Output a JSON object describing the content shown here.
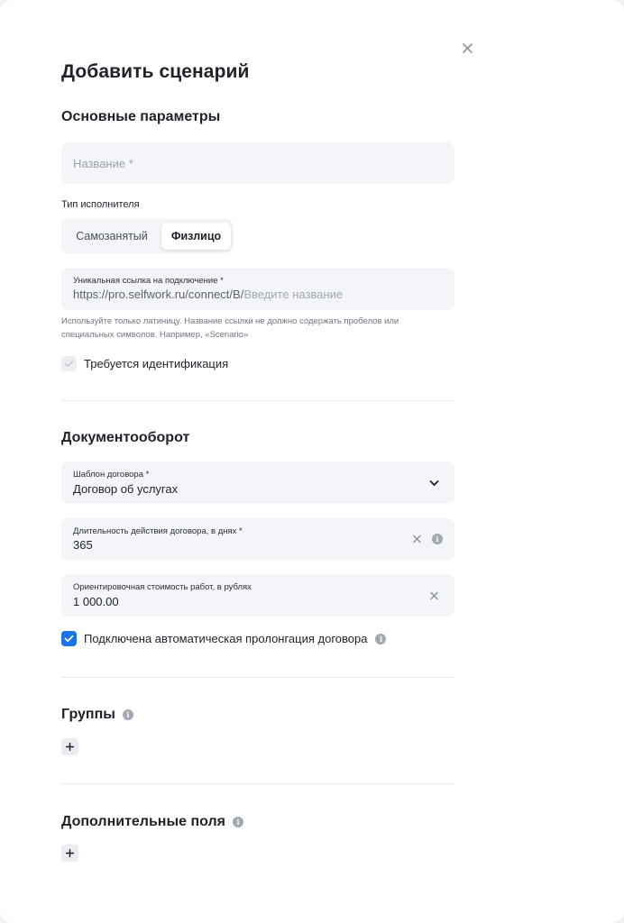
{
  "modal": {
    "title": "Добавить сценарий",
    "close_icon": "close-icon"
  },
  "basic": {
    "section_title": "Основные параметры",
    "name_placeholder": "Название *",
    "executor_type_label": "Тип исполнителя",
    "executor_options": [
      "Самозанятый",
      "Физлицо"
    ],
    "executor_selected": "Физлицо",
    "link_label": "Уникальная ссылка на подключение *",
    "link_prefix": "https://pro.selfwork.ru/connect/B/",
    "link_placeholder": "Введите название",
    "hint_line1": "Используйте только латиницу. Название ссылки не должно содержать пробелов или",
    "hint_line2": "специальных символов. Например, «Scenario»",
    "identification_label": "Требуется идентификация",
    "identification_checked": true,
    "identification_disabled": true
  },
  "documents": {
    "section_title": "Документооборот",
    "template_label": "Шаблон договора *",
    "template_value": "Договор об услугах",
    "duration_label": "Длительность действия договора, в днях *",
    "duration_value": "365",
    "cost_label": "Ориентировочная стоимость работ, в рублях",
    "cost_value": "1 000.00",
    "prolongation_label": "Подключена автоматическая пролонгация договора",
    "prolongation_checked": true
  },
  "groups": {
    "section_title": "Группы",
    "add_icon": "plus-icon"
  },
  "extra_fields": {
    "section_title": "Дополнительные поля",
    "add_icon": "plus-icon"
  },
  "colors": {
    "accent": "#1a73e8",
    "field_bg": "#f3f5f8",
    "text": "#1e2229",
    "muted": "#9aa1ad"
  }
}
